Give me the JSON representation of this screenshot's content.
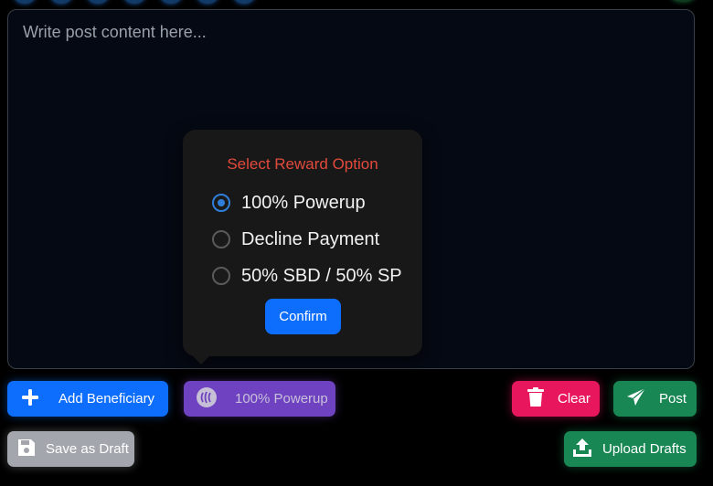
{
  "editor": {
    "placeholder": "Write post content here..."
  },
  "reward_popover": {
    "title": "Select Reward Option",
    "options": [
      {
        "label": "100% Powerup",
        "selected": true
      },
      {
        "label": "Decline Payment",
        "selected": false
      },
      {
        "label": "50% SBD / 50% SP",
        "selected": false
      }
    ],
    "confirm_label": "Confirm"
  },
  "toolbar": {
    "add_beneficiary_label": "Add Beneficiary",
    "reward_label": "100% Powerup",
    "clear_label": "Clear",
    "post_label": "Post",
    "save_draft_label": "Save as Draft",
    "upload_drafts_label": "Upload Drafts"
  },
  "colors": {
    "primary": "#0d6efd",
    "reward": "#6f42c1",
    "danger": "#e8175d",
    "success": "#198754",
    "secondary": "#a3a7ad",
    "title_red": "#e24a3c"
  },
  "icons": {
    "add_beneficiary": "plus-icon",
    "reward": "steem-icon",
    "clear": "trash-icon",
    "post": "paper-plane-icon",
    "save_draft": "floppy-disk-icon",
    "upload_drafts": "upload-icon"
  }
}
